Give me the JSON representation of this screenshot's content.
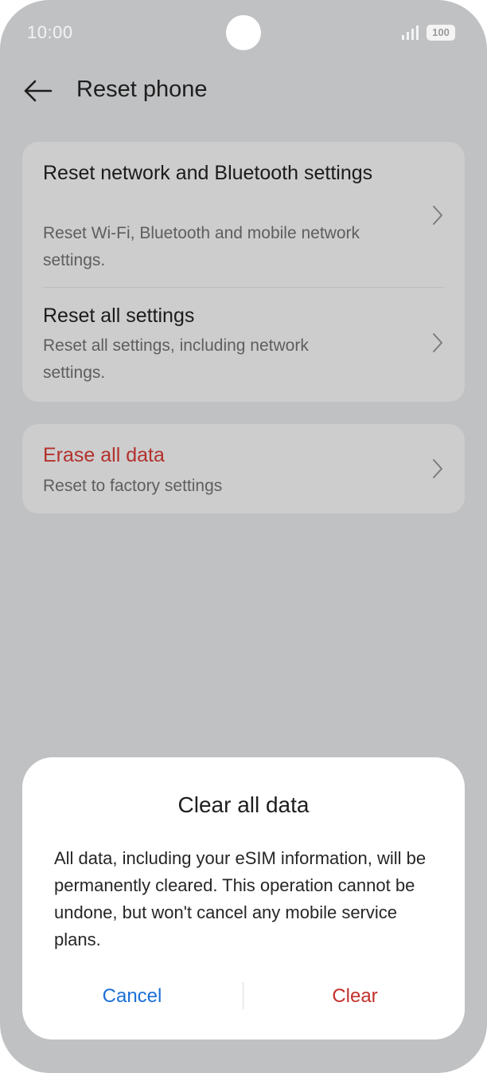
{
  "status_bar": {
    "time": "10:00",
    "battery": "100",
    "icons": [
      "signal-icon",
      "battery-icon"
    ]
  },
  "header": {
    "back_icon": "arrow-left-icon",
    "title": "Reset phone"
  },
  "settings": {
    "items": [
      {
        "title": "Reset network and Bluetooth settings",
        "subtitle": "Reset Wi-Fi, Bluetooth and mobile network settings."
      },
      {
        "title": "Reset all settings",
        "subtitle": "Reset all settings, including network settings."
      },
      {
        "title": "Erase all data",
        "subtitle": "Reset to factory settings"
      }
    ]
  },
  "dialog": {
    "title": "Clear all data",
    "message": "All data, including your eSIM information, will be permanently cleared. This operation cannot be undone, but won't cancel any mobile service plans.",
    "cancel_label": "Cancel",
    "confirm_label": "Clear"
  },
  "colors": {
    "scrim": "#c0c1c3",
    "card": "#cdcdce",
    "danger": "#b3312c",
    "accent": "#1a6fd8"
  }
}
